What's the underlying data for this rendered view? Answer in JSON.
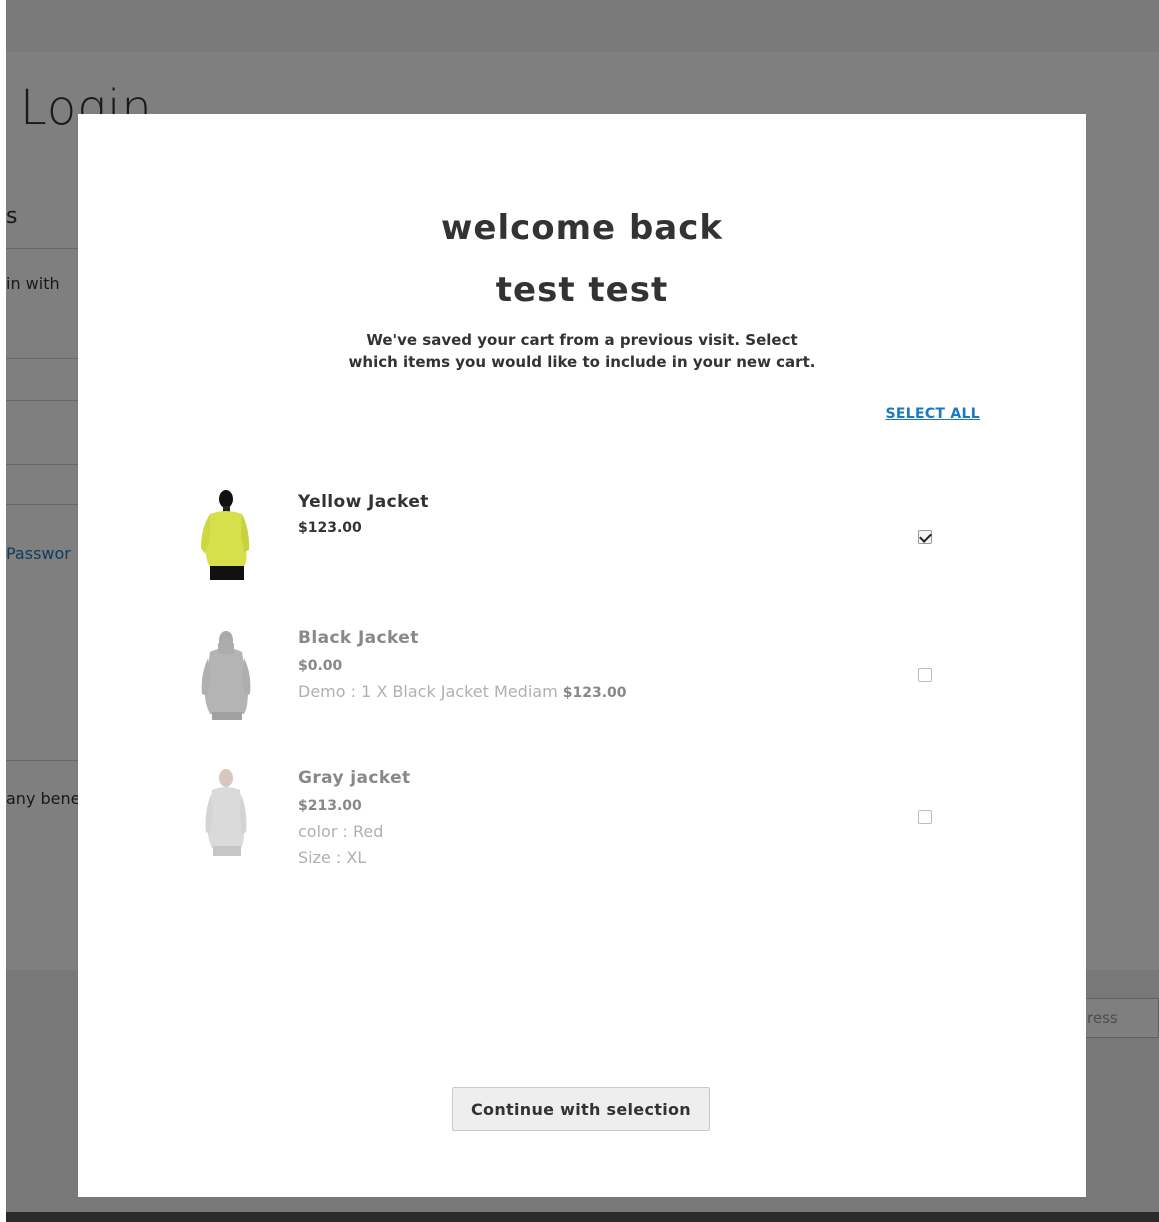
{
  "background": {
    "title": "Login",
    "section_heading": "s",
    "sign_in_text": "in with",
    "forgot_link": "Passwor",
    "benefits_text": "any bene",
    "footer_input_placeholder": "ress"
  },
  "modal": {
    "greeting": "welcome back",
    "customer_name": "test test",
    "message_line1": "We've saved your cart from a previous visit. Select",
    "message_line2": "which items you would like to include in your new cart.",
    "select_all_label": "SELECT ALL",
    "continue_label": "Continue with selection",
    "items": [
      {
        "name": "Yellow Jacket",
        "price": "$123.00",
        "options": [],
        "checked": true,
        "image_icon": "yellow-jacket-product-photo"
      },
      {
        "name": "Black Jacket",
        "price": "$0.00",
        "options": [
          "Demo : 1 X Black Jacket Mediam"
        ],
        "option_price": "$123.00",
        "checked": false,
        "image_icon": "black-jacket-product-photo"
      },
      {
        "name": "Gray jacket",
        "price": "$213.00",
        "options": [
          "color : Red",
          "Size : XL"
        ],
        "checked": false,
        "image_icon": "gray-jacket-product-photo"
      }
    ]
  },
  "colors": {
    "link": "#1979c3",
    "overlay": "rgba(0,0,0,0.5)",
    "jacket_yellow": "#d7e24b"
  }
}
